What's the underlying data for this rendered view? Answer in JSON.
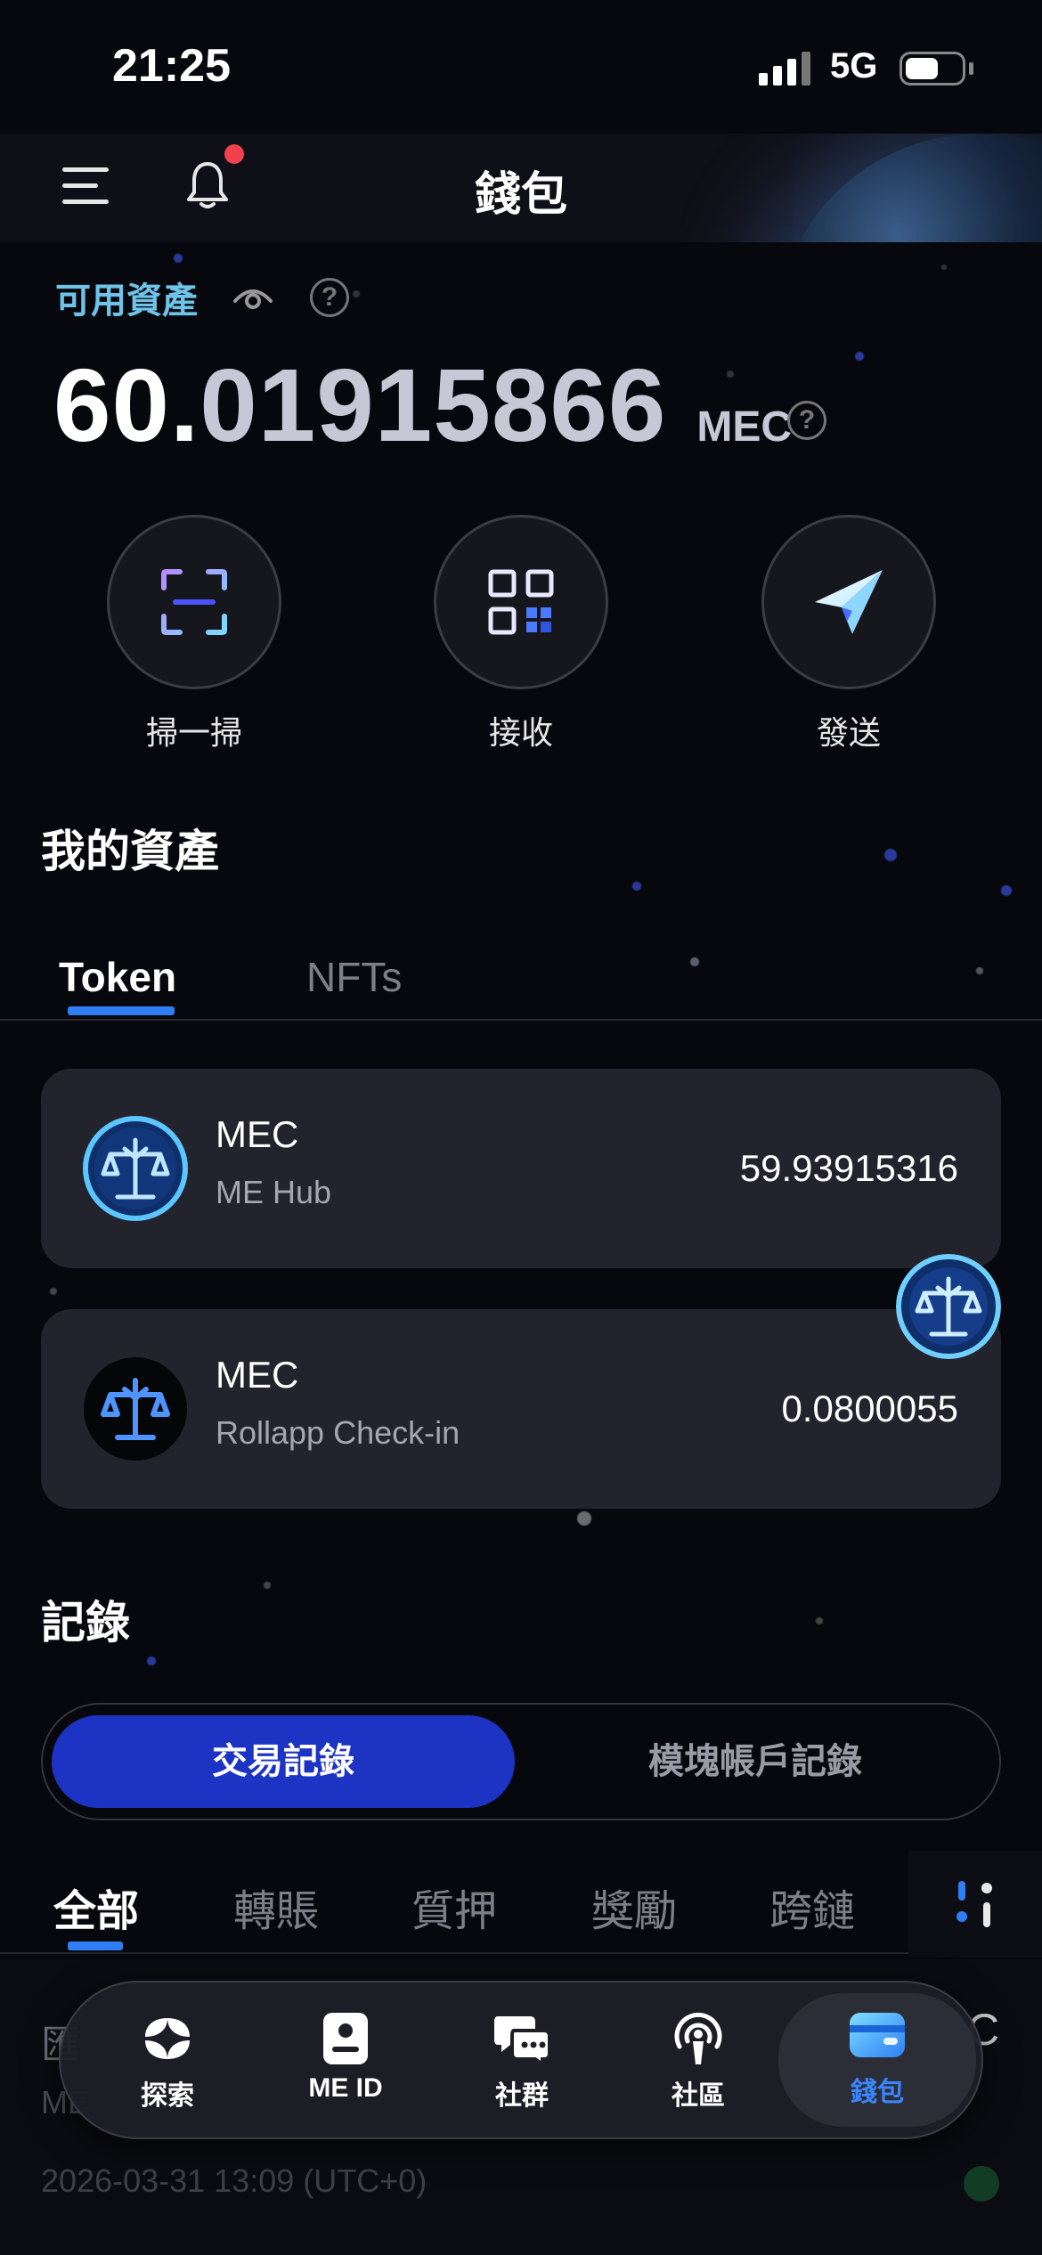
{
  "status_bar": {
    "time": "21:25",
    "network": "5G"
  },
  "header": {
    "title": "錢包"
  },
  "balance": {
    "label": "可用資產",
    "amount_int": "60.",
    "amount_dec": "01915866",
    "unit": "MEC",
    "help": "?"
  },
  "actions": [
    {
      "label": "掃一掃"
    },
    {
      "label": "接收"
    },
    {
      "label": "發送"
    }
  ],
  "assets": {
    "title": "我的資產",
    "tabs": [
      {
        "label": "Token"
      },
      {
        "label": "NFTs"
      }
    ],
    "tokens": [
      {
        "symbol": "MEC",
        "source": "ME Hub",
        "amount": "59.93915316"
      },
      {
        "symbol": "MEC",
        "source": "Rollapp Check-in",
        "amount": "0.0800055"
      }
    ]
  },
  "records": {
    "title": "記錄",
    "segments": [
      {
        "label": "交易記錄"
      },
      {
        "label": "模塊帳戶記錄"
      }
    ],
    "filters": [
      {
        "label": "全部"
      },
      {
        "label": "轉賬"
      },
      {
        "label": "質押"
      },
      {
        "label": "獎勵"
      },
      {
        "label": "跨鏈"
      }
    ],
    "entry": {
      "title_partial": "匯",
      "subtitle_partial": "ME",
      "right_partial": "C",
      "date": "2026-03-31 13:09 (UTC+0)"
    }
  },
  "nav": [
    {
      "label": "探索",
      "icon": "explore-icon"
    },
    {
      "label": "ME ID",
      "icon": "id-card-icon"
    },
    {
      "label": "社群",
      "icon": "chat-icon"
    },
    {
      "label": "社區",
      "icon": "broadcast-icon"
    },
    {
      "label": "錢包",
      "icon": "wallet-icon"
    }
  ],
  "colors": {
    "accent": "#2f7ef5",
    "segment_active": "#1d33c3",
    "available_label": "#6fc3e8",
    "notification_dot": "#f0414d"
  }
}
